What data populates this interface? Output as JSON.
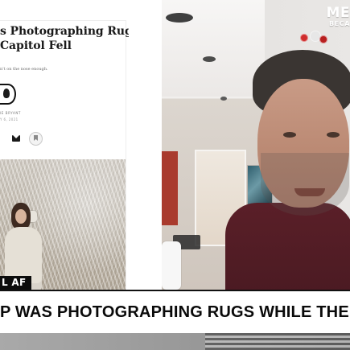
{
  "network_logo": {
    "main": "ME",
    "sub": "BECA"
  },
  "article": {
    "headline_line1": "s Photographing Rugs",
    "headline_line2": "Capitol Fell",
    "dek": "n't on the nose enough.",
    "byline_name": "IE BRYANT",
    "byline_date": "Y 6, 2021"
  },
  "show_tag": "L AF",
  "lower_third": {
    "headline": "P WAS PHOTOGRAPHING RUGS WHILE THE CAPITOL FELL"
  },
  "icons": {
    "email": "mail-icon",
    "bookmark": "bookmark-icon"
  },
  "colors": {
    "sweater": "#4a1a22",
    "lower_third_bg": "#ffffff",
    "lower_third_text": "#0a0a0a"
  }
}
